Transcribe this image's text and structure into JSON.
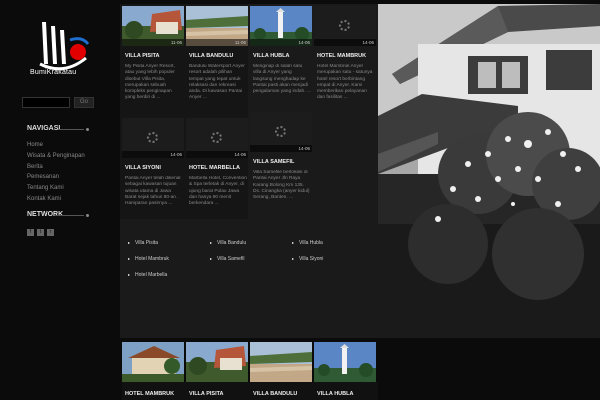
{
  "brand": {
    "name": "BumiKrakatau"
  },
  "search": {
    "placeholder": "",
    "button": "Go"
  },
  "nav": {
    "heading": "NAVIGASI",
    "items": [
      "Home",
      "Wisata & Penginapan",
      "Berita",
      "Pemesanan",
      "Tentang Kami",
      "Kontak Kami"
    ]
  },
  "network": {
    "heading": "NETWORK",
    "icons": [
      "facebook-icon",
      "twitter-icon",
      "rss-icon"
    ]
  },
  "tiles": [
    {
      "title": "VILLA PISITA",
      "date": "11-06",
      "desc": "My Pisita Anyer Resort, atau yang lebih populer disebut Villa Pisita, merupakan sebuah kompleks penginapan yang berdiri di ..."
    },
    {
      "title": "VILLA BANDULU",
      "date": "11-06",
      "desc": "Bandulu Watersport Anyer resort adalah pilihan tempat yang tepat untuk relaksasi dan rekreasi anda. Di kawasan Pantai Anyer ..."
    },
    {
      "title": "VILLA HUBLA",
      "date": "14-06",
      "desc": "Menginap di salah satu villa di Anyer yang langsung menghadap ke Pantai pasti akan menjadi pengalaman yang indah. ..."
    },
    {
      "title": "HOTEL MAMBRUK",
      "date": "14-06",
      "desc": "Hotel Mambruk Anyer merupakan satu - satunya hotel resort berbintang empat di Anyer. Kami memberikan pelayanan dan fasilitas ..."
    },
    {
      "title": "VILLA SIYONI",
      "date": "14-06",
      "desc": "Pantai Anyer telah dikenal sebagai kawasan tujuan wisata utama di Jawa Barat sejak tahun 80-an . Hamparan pasirnya ..."
    },
    {
      "title": "HOTEL MARBELLA",
      "date": "14-06",
      "desc": "Marbella Hotel, Convention & Spa terletak di Anyer, di ujung barat Pulau Jawa dan hanya 90 menit berkendara ..."
    },
    {
      "title": "VILLA SAMEFIL",
      "date": "14-06",
      "desc": "Villa Samefile berlokasi di Pantai Anyer Jln Raya Karang Bolong Km 135. Ds. Cinangka (anyer kidul) Serang, Banten. ..."
    }
  ],
  "links": [
    "Villa Pisita",
    "Villa Bandulu",
    "Villa Hubla",
    "Hotel Mambruk",
    "Villa Samefil",
    "Villa Siyoni",
    "Hotel Marbella"
  ],
  "bottom_tiles": [
    "HOTEL MAMBRUK",
    "VILLA PISITA",
    "VILLA BANDULU",
    "VILLA HUBLA"
  ],
  "colors": {
    "background": "#0b0b0b",
    "panel": "#1a1a1a",
    "text": "#bbbbbb",
    "accent_red": "#e00000"
  }
}
